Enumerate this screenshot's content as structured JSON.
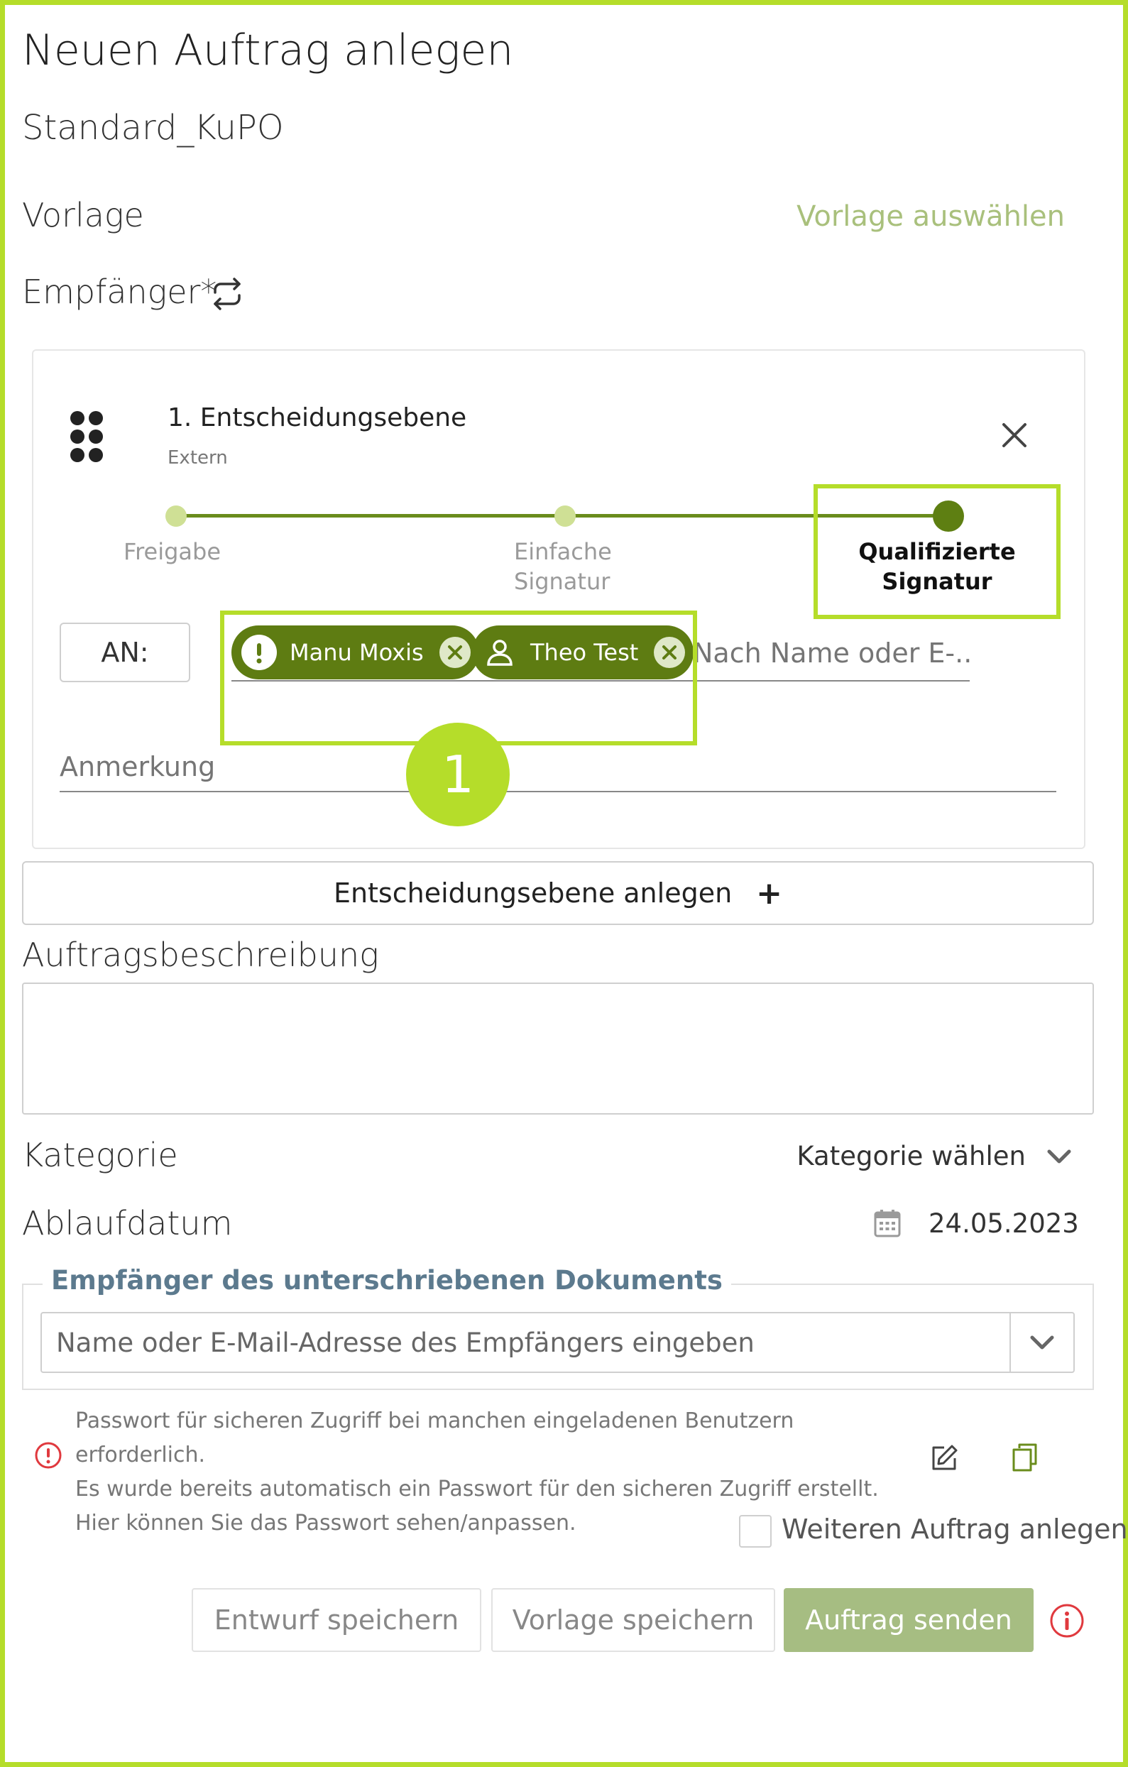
{
  "page": {
    "title": "Neuen Auftrag anlegen",
    "template_name": "Standard_KuPO"
  },
  "template": {
    "label": "Vorlage",
    "select_link": "Vorlage auswählen"
  },
  "recipients": {
    "label": "Empfänger*",
    "level": {
      "title": "1. Entscheidungsebene",
      "subtitle": "Extern",
      "steps": [
        {
          "label": "Freigabe",
          "active": false
        },
        {
          "label": "Einfache Signatur",
          "active": false
        },
        {
          "label": "Qualifizierte Signatur",
          "active": true
        }
      ],
      "to_label": "AN:",
      "chips": [
        {
          "name": "Manu Moxis",
          "icon": "warning-icon"
        },
        {
          "name": "Theo Test",
          "icon": "person-icon"
        }
      ],
      "search_placeholder": "Nach Name oder E-...",
      "note_placeholder": "Anmerkung"
    },
    "callout_number": "1",
    "add_level_button": "Entscheidungsebene anlegen"
  },
  "description": {
    "label": "Auftragsbeschreibung"
  },
  "category": {
    "label": "Kategorie",
    "value": "Kategorie wählen"
  },
  "expiry": {
    "label": "Ablaufdatum",
    "value": "24.05.2023"
  },
  "signed_recipient": {
    "legend": "Empfänger des unterschriebenen Dokuments",
    "placeholder": "Name oder E-Mail-Adresse des Empfängers eingeben"
  },
  "password_notice": {
    "line1": "Passwort für sicheren Zugriff bei manchen eingeladenen Benutzern erforderlich.",
    "line2": "Es wurde bereits automatisch ein Passwort für den sicheren Zugriff erstellt. Hier können Sie das Passwort sehen/anpassen."
  },
  "another_order": {
    "label": "Weiteren Auftrag anlegen"
  },
  "actions": {
    "save_draft": "Entwurf speichern",
    "save_template": "Vorlage speichern",
    "send": "Auftrag senden"
  },
  "colors": {
    "accent": "#b5dd2a",
    "chip": "#5e7c12",
    "primary_button": "#a6bd82",
    "error": "#e0393e"
  }
}
